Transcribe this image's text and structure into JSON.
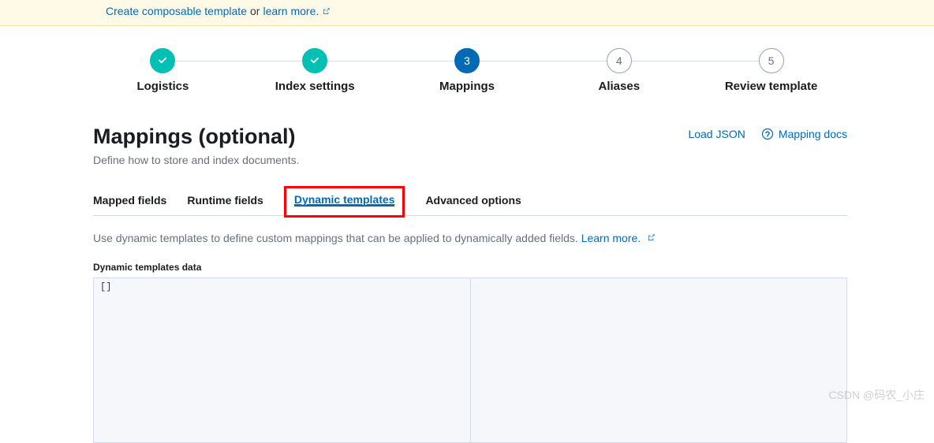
{
  "banner": {
    "create_link": "Create composable template",
    "or_text": " or ",
    "learn_more": "learn more."
  },
  "steps": [
    {
      "label": "Logistics",
      "state": "done"
    },
    {
      "label": "Index settings",
      "state": "done"
    },
    {
      "label": "Mappings",
      "state": "active",
      "num": "3"
    },
    {
      "label": "Aliases",
      "state": "pending",
      "num": "4"
    },
    {
      "label": "Review template",
      "state": "pending",
      "num": "5"
    }
  ],
  "header": {
    "title": "Mappings (optional)",
    "subtitle": "Define how to store and index documents.",
    "load_json": "Load JSON",
    "mapping_docs": "Mapping docs"
  },
  "tabs": {
    "mapped_fields": "Mapped fields",
    "runtime_fields": "Runtime fields",
    "dynamic_templates": "Dynamic templates",
    "advanced_options": "Advanced options"
  },
  "desc": {
    "text": "Use dynamic templates to define custom mappings that can be applied to dynamically added fields. ",
    "learn_more": "Learn more."
  },
  "editor": {
    "label": "Dynamic templates data",
    "content": "[]"
  },
  "watermark": "CSDN @码农_小庄"
}
